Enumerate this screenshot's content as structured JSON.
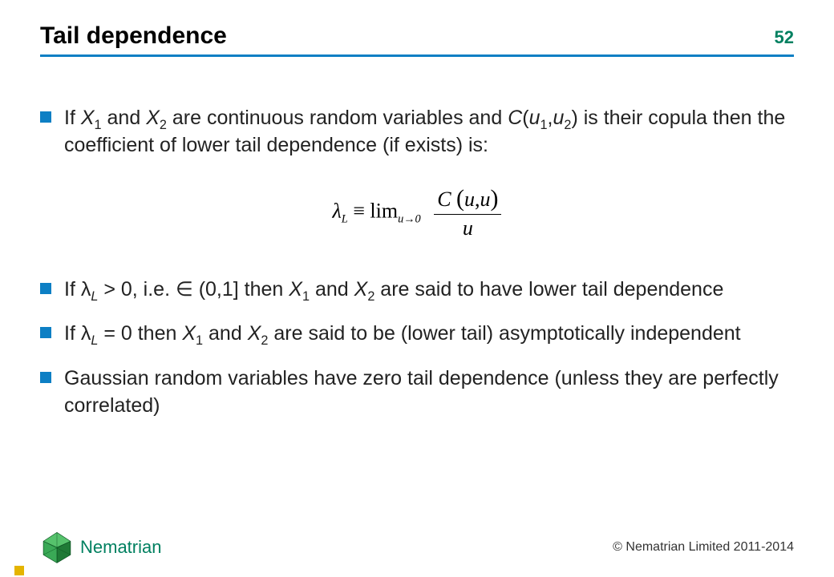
{
  "header": {
    "title": "Tail dependence",
    "page_number": "52"
  },
  "bullets": {
    "b1_pre": "If ",
    "b1_x1": "X",
    "b1_s1": "1",
    "b1_and": " and ",
    "b1_x2": "X",
    "b1_s2": "2",
    "b1_mid": " are continuous random variables and ",
    "b1_C": "C",
    "b1_paren_open": "(",
    "b1_u1": "u",
    "b1_u1s": "1",
    "b1_comma": ",",
    "b1_u2": "u",
    "b1_u2s": "2",
    "b1_paren_close": ")",
    "b1_post": " is their copula then the coefficient of lower tail dependence (if exists) is:",
    "b2_pre": "If ",
    "b2_lam": "λ",
    "b2_lam_sub": "L",
    "b2_gt": " > 0, i.e. ∈ (0,1] then ",
    "b2_x1": "X",
    "b2_s1": "1",
    "b2_and": " and ",
    "b2_x2": "X",
    "b2_s2": "2",
    "b2_post": " are said to have lower tail dependence",
    "b3_pre": "If ",
    "b3_lam": "λ",
    "b3_lam_sub": "L",
    "b3_eq": " = 0 then ",
    "b3_x1": "X",
    "b3_s1": "1",
    "b3_and": " and ",
    "b3_x2": "X",
    "b3_s2": "2",
    "b3_post": " are said to be (lower tail) asymptotically independent",
    "b4": "Gaussian random variables have zero tail dependence (unless they are perfectly correlated)"
  },
  "formula": {
    "lambda": "λ",
    "lambda_sub": "L",
    "equiv": " ≡ ",
    "lim": "lim",
    "lim_sub": "u→0",
    "num_C": "C",
    "num_open": "(",
    "num_u1": "u",
    "num_comma": ",",
    "num_u2": "u",
    "num_close": ")",
    "den": "u"
  },
  "footer": {
    "brand": "Nematrian",
    "copyright": "© Nematrian Limited 2011-2014"
  }
}
